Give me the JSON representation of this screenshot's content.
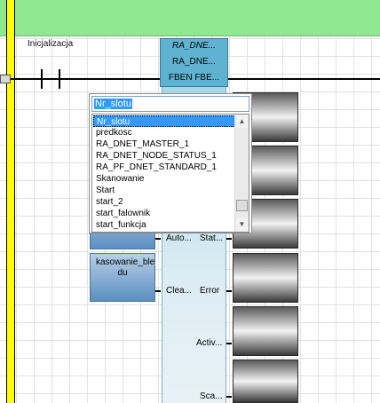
{
  "rung": {
    "label": "Inicjalizacja"
  },
  "function_block": {
    "instance_name": "RA_DNE...",
    "type_name": "RA_DNE...",
    "header_pins": "FBEN  FBE...",
    "pins_left": [
      "Auto...",
      "Clea..."
    ],
    "pins_right": [
      "Stat...",
      "Error",
      "Activ...",
      "Sca..."
    ]
  },
  "input_tags": [
    {
      "label": ""
    },
    {
      "label": "kasowanie_ble du"
    }
  ],
  "dropdown": {
    "combo_value": "Nr_slotu",
    "items": [
      "Nr_slotu",
      "predkosc",
      "RA_DNET_MASTER_1",
      "RA_DNET_NODE_STATUS_1",
      "RA_PF_DNET_STANDARD_1",
      "Skanowanie",
      "Start",
      "start_2",
      "start_falownik",
      "start_funkcja"
    ],
    "selected_index": 0
  },
  "colors": {
    "top_band": "#8fe88f",
    "left_rail": "#ffff00",
    "fb_header": "#5fb3d0",
    "selection": "#3399ff"
  }
}
